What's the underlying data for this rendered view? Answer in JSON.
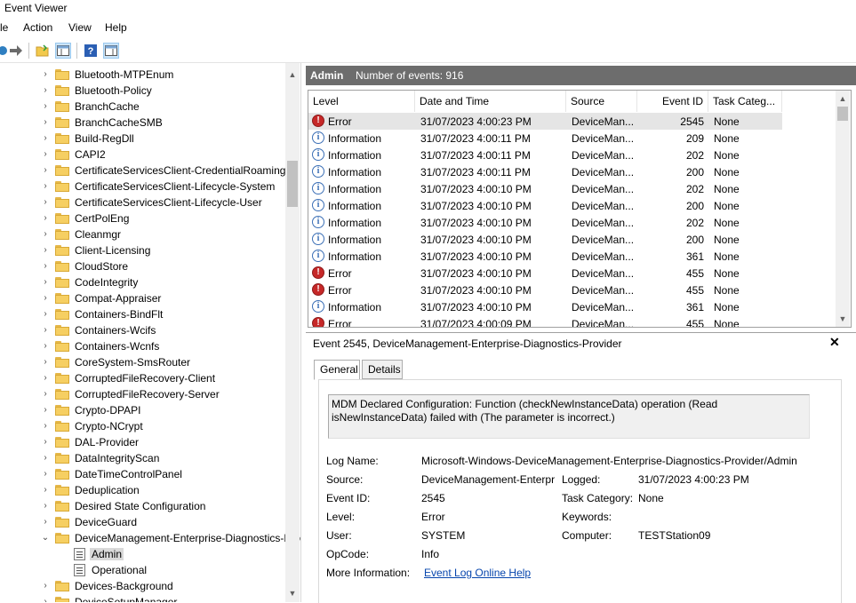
{
  "window": {
    "title": "Event Viewer"
  },
  "menu": [
    "le",
    "Action",
    "View",
    "Help"
  ],
  "tree": {
    "items": [
      {
        "label": "Bluetooth-MTPEnum",
        "chev": "›"
      },
      {
        "label": "Bluetooth-Policy",
        "chev": "›"
      },
      {
        "label": "BranchCache",
        "chev": "›"
      },
      {
        "label": "BranchCacheSMB",
        "chev": "›"
      },
      {
        "label": "Build-RegDll",
        "chev": "›"
      },
      {
        "label": "CAPI2",
        "chev": "›"
      },
      {
        "label": "CertificateServicesClient-CredentialRoaming",
        "chev": "›"
      },
      {
        "label": "CertificateServicesClient-Lifecycle-System",
        "chev": "›"
      },
      {
        "label": "CertificateServicesClient-Lifecycle-User",
        "chev": "›"
      },
      {
        "label": "CertPolEng",
        "chev": "›"
      },
      {
        "label": "Cleanmgr",
        "chev": "›"
      },
      {
        "label": "Client-Licensing",
        "chev": "›"
      },
      {
        "label": "CloudStore",
        "chev": "›"
      },
      {
        "label": "CodeIntegrity",
        "chev": "›"
      },
      {
        "label": "Compat-Appraiser",
        "chev": "›"
      },
      {
        "label": "Containers-BindFlt",
        "chev": "›"
      },
      {
        "label": "Containers-Wcifs",
        "chev": "›"
      },
      {
        "label": "Containers-Wcnfs",
        "chev": "›"
      },
      {
        "label": "CoreSystem-SmsRouter",
        "chev": "›"
      },
      {
        "label": "CorruptedFileRecovery-Client",
        "chev": "›"
      },
      {
        "label": "CorruptedFileRecovery-Server",
        "chev": "›"
      },
      {
        "label": "Crypto-DPAPI",
        "chev": "›"
      },
      {
        "label": "Crypto-NCrypt",
        "chev": "›"
      },
      {
        "label": "DAL-Provider",
        "chev": "›"
      },
      {
        "label": "DataIntegrityScan",
        "chev": "›"
      },
      {
        "label": "DateTimeControlPanel",
        "chev": "›"
      },
      {
        "label": "Deduplication",
        "chev": "›"
      },
      {
        "label": "Desired State Configuration",
        "chev": "›"
      },
      {
        "label": "DeviceGuard",
        "chev": "›"
      },
      {
        "label": "DeviceManagement-Enterprise-Diagnostics-Provider",
        "chev": "⌄"
      },
      {
        "label": "Admin",
        "chev": "",
        "child": true,
        "selected": true
      },
      {
        "label": "Operational",
        "chev": "",
        "child": true
      },
      {
        "label": "Devices-Background",
        "chev": "›"
      },
      {
        "label": "DeviceSetupManager",
        "chev": "›"
      }
    ]
  },
  "header": {
    "log": "Admin",
    "count": "Number of events: 916"
  },
  "grid": {
    "columns": [
      "Level",
      "Date and Time",
      "Source",
      "Event ID",
      "Task Categ..."
    ],
    "rows": [
      {
        "level": "Error",
        "date": "31/07/2023 4:00:23 PM",
        "source": "DeviceMan...",
        "id": "2545",
        "task": "None"
      },
      {
        "level": "Information",
        "date": "31/07/2023 4:00:11 PM",
        "source": "DeviceMan...",
        "id": "209",
        "task": "None"
      },
      {
        "level": "Information",
        "date": "31/07/2023 4:00:11 PM",
        "source": "DeviceMan...",
        "id": "202",
        "task": "None"
      },
      {
        "level": "Information",
        "date": "31/07/2023 4:00:11 PM",
        "source": "DeviceMan...",
        "id": "200",
        "task": "None"
      },
      {
        "level": "Information",
        "date": "31/07/2023 4:00:10 PM",
        "source": "DeviceMan...",
        "id": "202",
        "task": "None"
      },
      {
        "level": "Information",
        "date": "31/07/2023 4:00:10 PM",
        "source": "DeviceMan...",
        "id": "200",
        "task": "None"
      },
      {
        "level": "Information",
        "date": "31/07/2023 4:00:10 PM",
        "source": "DeviceMan...",
        "id": "202",
        "task": "None"
      },
      {
        "level": "Information",
        "date": "31/07/2023 4:00:10 PM",
        "source": "DeviceMan...",
        "id": "200",
        "task": "None"
      },
      {
        "level": "Information",
        "date": "31/07/2023 4:00:10 PM",
        "source": "DeviceMan...",
        "id": "361",
        "task": "None"
      },
      {
        "level": "Error",
        "date": "31/07/2023 4:00:10 PM",
        "source": "DeviceMan...",
        "id": "455",
        "task": "None"
      },
      {
        "level": "Error",
        "date": "31/07/2023 4:00:10 PM",
        "source": "DeviceMan...",
        "id": "455",
        "task": "None"
      },
      {
        "level": "Information",
        "date": "31/07/2023 4:00:10 PM",
        "source": "DeviceMan...",
        "id": "361",
        "task": "None"
      },
      {
        "level": "Error",
        "date": "31/07/2023 4:00:09 PM",
        "source": "DeviceMan...",
        "id": "455",
        "task": "None"
      }
    ]
  },
  "detail": {
    "title": "Event 2545, DeviceManagement-Enterprise-Diagnostics-Provider",
    "tabs": [
      "General",
      "Details"
    ],
    "description": "MDM Declared Configuration: Function (checkNewInstanceData) operation (Read isNewInstanceData) failed with (The parameter is incorrect.)",
    "log_name_label": "Log Name:",
    "log_name": "Microsoft-Windows-DeviceManagement-Enterprise-Diagnostics-Provider/Admin",
    "source_label": "Source:",
    "source": "DeviceManagement-Enterpr",
    "logged_label": "Logged:",
    "logged": "31/07/2023 4:00:23 PM",
    "event_id_label": "Event ID:",
    "event_id": "2545",
    "task_label": "Task Category:",
    "task": "None",
    "level_label": "Level:",
    "level": "Error",
    "keywords_label": "Keywords:",
    "keywords": "",
    "user_label": "User:",
    "user": "SYSTEM",
    "computer_label": "Computer:",
    "computer": "TESTStation09",
    "opcode_label": "OpCode:",
    "opcode": "Info",
    "more_label": "More Information:",
    "more_link": "Event Log Online Help"
  }
}
